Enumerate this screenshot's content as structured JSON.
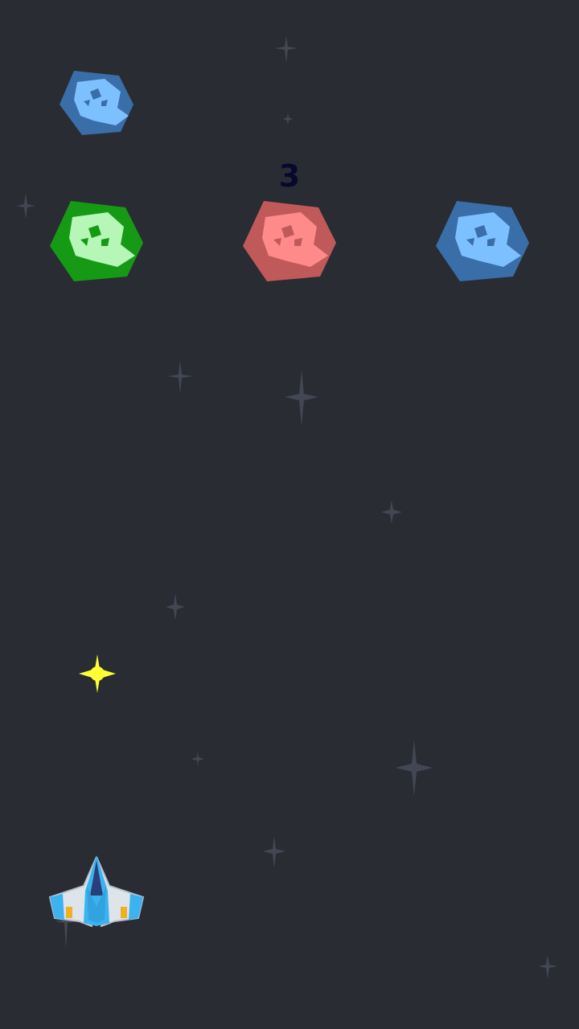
{
  "game": {
    "background_color": "#2a2c33",
    "counter": "3"
  },
  "asteroids": [
    {
      "name": "asteroid-blue-small",
      "color_outer": "#3a6ea8",
      "color_inner": "#7cc0ff"
    },
    {
      "name": "asteroid-green",
      "color_outer": "#169a16",
      "color_inner": "#b6f6b6"
    },
    {
      "name": "asteroid-red",
      "color_outer": "#c05a5a",
      "color_inner": "#ff8a8a"
    },
    {
      "name": "asteroid-blue",
      "color_outer": "#3a6ea8",
      "color_inner": "#7cc0ff"
    }
  ],
  "bullet": {
    "icon": "yellow-star-icon",
    "color": "#ffff33"
  },
  "player": {
    "icon": "spaceship-icon",
    "color_body": "#dde4ea",
    "color_cockpit": "#3bb3f0"
  }
}
